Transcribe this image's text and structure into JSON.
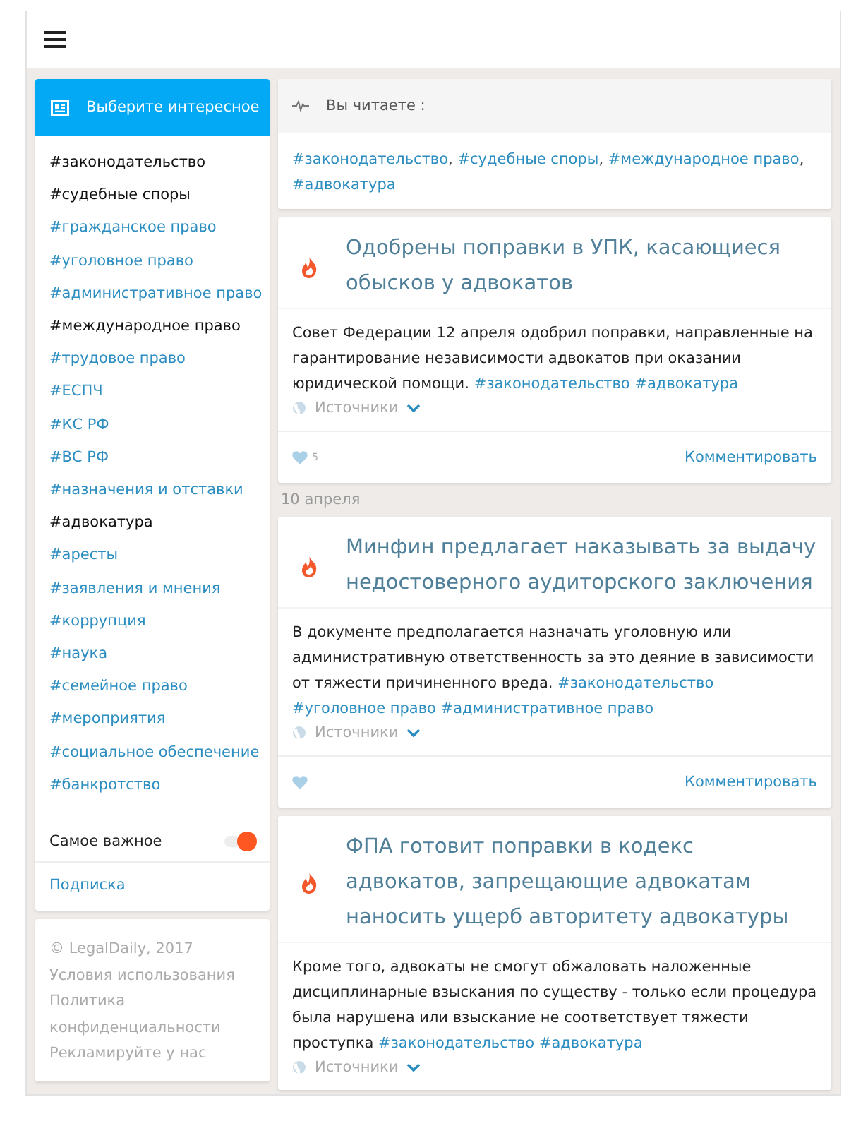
{
  "sidebar": {
    "header": "Выберите интересное",
    "tags": [
      {
        "label": "#законодательство",
        "selected": true
      },
      {
        "label": "#судебные споры",
        "selected": true
      },
      {
        "label": "#гражданское право",
        "selected": false
      },
      {
        "label": "#уголовное право",
        "selected": false
      },
      {
        "label": "#административное право",
        "selected": false
      },
      {
        "label": "#международное право",
        "selected": true
      },
      {
        "label": "#трудовое право",
        "selected": false
      },
      {
        "label": "#ЕСПЧ",
        "selected": false
      },
      {
        "label": "#КС РФ",
        "selected": false
      },
      {
        "label": "#ВС РФ",
        "selected": false
      },
      {
        "label": "#назначения и отставки",
        "selected": false
      },
      {
        "label": "#адвокатура",
        "selected": true
      },
      {
        "label": "#аресты",
        "selected": false
      },
      {
        "label": "#заявления и мнения",
        "selected": false
      },
      {
        "label": "#коррупция",
        "selected": false
      },
      {
        "label": "#наука",
        "selected": false
      },
      {
        "label": "#семейное право",
        "selected": false
      },
      {
        "label": "#мероприятия",
        "selected": false
      },
      {
        "label": "#социальное обеспечение",
        "selected": false
      },
      {
        "label": "#банкротство",
        "selected": false
      }
    ],
    "important": {
      "label": "Самое важное",
      "on": true
    },
    "subscribe": "Подписка",
    "footer": [
      "© LegalDaily, 2017",
      "Условия использования",
      "Политика конфиденциальности",
      "Рекламируйте у нас"
    ]
  },
  "reading": {
    "title": "Вы читаете :",
    "separator": ",",
    "tags": [
      "#законодательство",
      "#судебные споры",
      "#международное право",
      "#адвокатура"
    ]
  },
  "feed": [
    {
      "kind": "post",
      "title": "Одобрены поправки в УПК, касающиеся обысков у адвокатов",
      "text": "Совет Федерации 12 апреля одобрил поправки, направленные на гарантирование независимости адвокатов при оказании юридической помощи.",
      "tags": [
        "#законодательство",
        "#адвокатура"
      ],
      "sources": "Источники",
      "likes": "5",
      "comment": "Комментировать"
    },
    {
      "kind": "date",
      "label": "10 апреля"
    },
    {
      "kind": "post",
      "title": "Минфин предлагает наказывать за выдачу недостоверного аудиторского заключения",
      "text": "В документе предполагается назначать уголовную или административную ответственность за это деяние в зависимости от тяжести причиненного вреда.",
      "tags": [
        "#законодательство",
        "#уголовное право",
        "#административное право"
      ],
      "sources": "Источники",
      "comment": "Комментировать"
    },
    {
      "kind": "post",
      "title": "ФПА готовит поправки в кодекс адвокатов, запрещающие адвокатам наносить ущерб авторитету адвокатуры",
      "text": "Кроме того, адвокаты не смогут обжаловать наложенные дисциплинарные взыскания по существу - только если процедура была нарушена или взыскание не соответствует тяжести проступка",
      "tags": [
        "#законодательство",
        "#адвокатура"
      ],
      "sources": "Источники"
    }
  ]
}
